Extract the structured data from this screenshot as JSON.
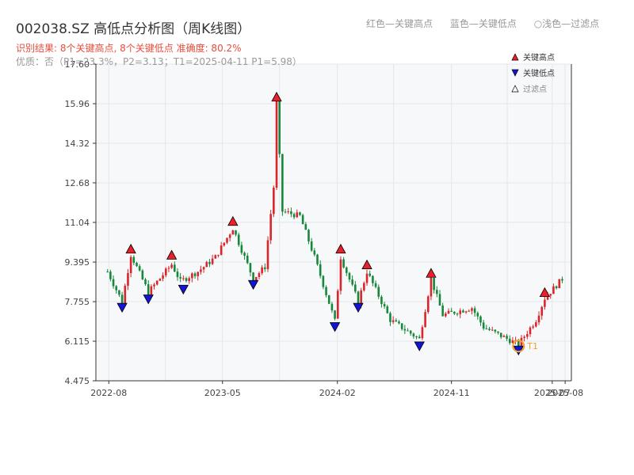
{
  "header": {
    "title": "002038.SZ 高低点分析图（周K线图）",
    "legend_red": "红色—关键高点",
    "legend_blue": "蓝色—关键低点",
    "legend_light": "○浅色—过滤点",
    "result": "识别结果: 8个关键高点, 8个关键低点   准确度: 80.2%",
    "quality": "优质：否（P1=23.3%，P2=3.13；T1=2025-04-11 P1=5.98）"
  },
  "colors": {
    "up": "#d9252b",
    "down": "#17873a",
    "high": "#e8202a",
    "low": "#1414d4",
    "t1": "#f0a030",
    "grid": "#e3e6ea",
    "plotBg": "#f7f8fa"
  },
  "chart_data": {
    "type": "candlestick",
    "title": "002038.SZ 高低点分析图（周K线图）",
    "ylim": [
      4.475,
      17.6
    ],
    "y_ticks": [
      4.475,
      6.115,
      7.755,
      9.395,
      11.04,
      12.68,
      14.32,
      15.96,
      17.6
    ],
    "y_tick_labels": [
      "4.475",
      "6.115",
      "7.755",
      "9.395",
      "11.04",
      "12.68",
      "14.32",
      "15.96",
      "17.60"
    ],
    "x_ticks": [
      "2022-08",
      "2023-05",
      "2024-02",
      "2024-11",
      "2025-07",
      "2025-08"
    ],
    "legend": [
      "关键高点",
      "关键低点",
      "过滤点"
    ],
    "annotation": "T1",
    "price_path": [
      [
        "2022-07-29",
        9.0
      ],
      [
        "2022-09-02",
        7.75
      ],
      [
        "2022-09-23",
        9.7
      ],
      [
        "2022-11-04",
        8.15
      ],
      [
        "2022-12-30",
        9.3
      ],
      [
        "2023-01-20",
        8.6
      ],
      [
        "2023-03-03",
        9.0
      ],
      [
        "2023-04-14",
        9.6
      ],
      [
        "2023-05-26",
        10.8
      ],
      [
        "2023-07-14",
        8.7
      ],
      [
        "2023-08-11",
        9.2
      ],
      [
        "2023-09-01",
        12.5
      ],
      [
        "2023-09-08",
        16.0
      ],
      [
        "2023-09-22",
        11.5
      ],
      [
        "2023-11-03",
        11.3
      ],
      [
        "2023-12-08",
        9.6
      ],
      [
        "2024-01-26",
        6.95
      ],
      [
        "2024-02-09",
        9.6
      ],
      [
        "2024-03-22",
        7.75
      ],
      [
        "2024-04-12",
        9.0
      ],
      [
        "2024-06-07",
        7.0
      ],
      [
        "2024-08-16",
        6.2
      ],
      [
        "2024-09-13",
        8.7
      ],
      [
        "2024-10-11",
        7.2
      ],
      [
        "2024-12-20",
        7.5
      ],
      [
        "2025-01-17",
        6.7
      ],
      [
        "2025-04-11",
        5.98
      ],
      [
        "2025-05-23",
        7.0
      ],
      [
        "2025-06-13",
        7.9
      ],
      [
        "2025-07-25",
        8.7
      ]
    ],
    "key_highs": [
      {
        "date": "2022-09-23",
        "price": 9.7
      },
      {
        "date": "2022-12-30",
        "price": 9.45
      },
      {
        "date": "2023-05-26",
        "price": 10.85
      },
      {
        "date": "2023-09-08",
        "price": 16.0
      },
      {
        "date": "2024-02-09",
        "price": 9.7
      },
      {
        "date": "2024-04-12",
        "price": 9.05
      },
      {
        "date": "2024-09-13",
        "price": 8.7
      },
      {
        "date": "2025-06-13",
        "price": 7.9
      }
    ],
    "key_lows": [
      {
        "date": "2022-09-02",
        "price": 7.75
      },
      {
        "date": "2022-11-04",
        "price": 8.1
      },
      {
        "date": "2023-01-27",
        "price": 8.5
      },
      {
        "date": "2023-07-14",
        "price": 8.7
      },
      {
        "date": "2024-01-26",
        "price": 6.95
      },
      {
        "date": "2024-03-22",
        "price": 7.75
      },
      {
        "date": "2024-08-16",
        "price": 6.15
      },
      {
        "date": "2025-04-11",
        "price": 5.98
      }
    ],
    "t1": {
      "date": "2025-04-11",
      "price": 5.98
    }
  }
}
